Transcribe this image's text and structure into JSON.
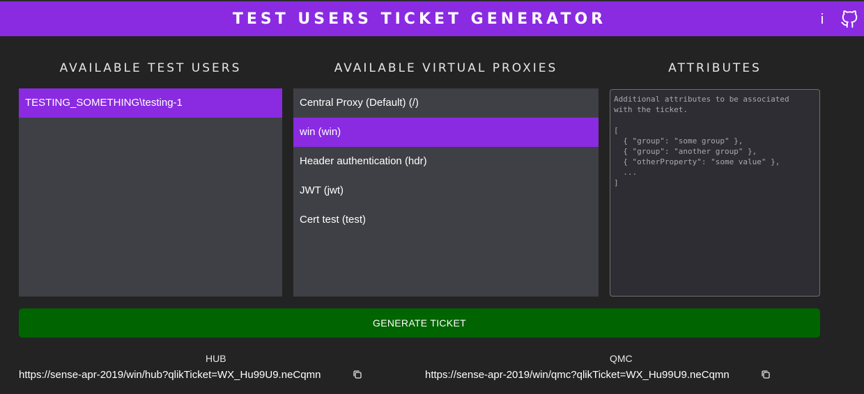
{
  "header": {
    "title": "TEST USERS TICKET GENERATOR",
    "info_label": "i",
    "github_icon": "github-icon",
    "background": "#8a2be2"
  },
  "users": {
    "title": "AVAILABLE TEST USERS",
    "items": [
      {
        "label": "TESTING_SOMETHING\\testing-1",
        "selected": true
      }
    ]
  },
  "proxies": {
    "title": "AVAILABLE VIRTUAL PROXIES",
    "items": [
      {
        "label": "Central Proxy (Default) (/)",
        "selected": false
      },
      {
        "label": "win (win)",
        "selected": true
      },
      {
        "label": "Header authentication (hdr)",
        "selected": false
      },
      {
        "label": "JWT (jwt)",
        "selected": false
      },
      {
        "label": "Cert test (test)",
        "selected": false
      }
    ]
  },
  "attributes": {
    "title": "ATTRIBUTES",
    "value": "",
    "placeholder": "Additional attributes to be associated\nwith the ticket.\n\n[\n  { \"group\": \"some group\" },\n  { \"group\": \"another group\" },\n  { \"otherProperty\": \"some value\" },\n  ...\n]"
  },
  "generate": {
    "label": "GENERATE TICKET",
    "color": "#006400"
  },
  "links": {
    "hub": {
      "label": "HUB",
      "url": "https://sense-apr-2019/win/hub?qlikTicket=WX_Hu99U9.neCqmn",
      "copy_icon": "copy-icon"
    },
    "qmc": {
      "label": "QMC",
      "url": "https://sense-apr-2019/win/qmc?qlikTicket=WX_Hu99U9.neCqmn",
      "copy_icon": "copy-icon"
    }
  }
}
